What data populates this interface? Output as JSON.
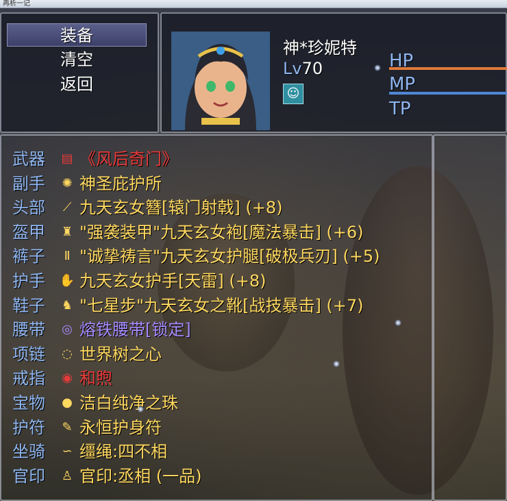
{
  "window": {
    "title": "再析一记"
  },
  "menu": {
    "items": [
      {
        "label": "装备",
        "selected": true
      },
      {
        "label": "清空",
        "selected": false
      },
      {
        "label": "返回",
        "selected": false
      }
    ]
  },
  "actor": {
    "name": "神*珍妮特",
    "level_label": "Lv",
    "level": "70",
    "state_icon": "status-icon",
    "gauges": [
      {
        "label": "HP",
        "fill": 1.0,
        "color": "#e07a3a"
      },
      {
        "label": "MP",
        "fill": 1.0,
        "color": "#4f86d6"
      },
      {
        "label": "TP",
        "fill": 0.0,
        "color": "#4fb36b"
      }
    ]
  },
  "colors": {
    "slot_label": "#8fb6f0",
    "item_default": "#ffd860",
    "item_red": "#e83a3a",
    "item_purple": "#a58cff"
  },
  "equipment": [
    {
      "slot": "武器",
      "icon": "scroll-icon",
      "glyph": "▤",
      "name": "《风后奇门》",
      "color": "#e83a3a"
    },
    {
      "slot": "副手",
      "icon": "shield-icon",
      "glyph": "✺",
      "name": "神圣庇护所",
      "color": "#ffd860"
    },
    {
      "slot": "头部",
      "icon": "hairpin-icon",
      "glyph": "⟋",
      "name": "九天玄女簪[辕门射戟] (+8)",
      "color": "#ffd860"
    },
    {
      "slot": "盔甲",
      "icon": "robe-icon",
      "glyph": "♜",
      "name": "\"强袭装甲\"九天玄女袍[魔法暴击] (+6)",
      "color": "#ffd860"
    },
    {
      "slot": "裤子",
      "icon": "pants-icon",
      "glyph": "Ⅱ",
      "name": "\"诚挚祷言\"九天玄女护腿[破极兵刃] (+5)",
      "color": "#ffd860"
    },
    {
      "slot": "护手",
      "icon": "gauntlet-icon",
      "glyph": "✋",
      "name": "九天玄女护手[天雷] (+8)",
      "color": "#ffd860"
    },
    {
      "slot": "鞋子",
      "icon": "boots-icon",
      "glyph": "♞",
      "name": "\"七星步\"九天玄女之靴[战技暴击] (+7)",
      "color": "#ffd860"
    },
    {
      "slot": "腰带",
      "icon": "belt-icon",
      "glyph": "◎",
      "name": "熔铁腰带[锁定]",
      "color": "#a58cff"
    },
    {
      "slot": "项链",
      "icon": "necklace-icon",
      "glyph": "◌",
      "name": "世界树之心",
      "color": "#ffd860"
    },
    {
      "slot": "戒指",
      "icon": "ring-icon",
      "glyph": "◉",
      "name": "和煦",
      "color": "#e83a3a"
    },
    {
      "slot": "宝物",
      "icon": "pearl-icon",
      "glyph": "●",
      "name": "洁白纯净之珠",
      "color": "#ffd860"
    },
    {
      "slot": "护符",
      "icon": "charm-icon",
      "glyph": "✎",
      "name": "永恒护身符",
      "color": "#ffd860"
    },
    {
      "slot": "坐骑",
      "icon": "rope-icon",
      "glyph": "∽",
      "name": "缰绳:四不相",
      "color": "#ffd860"
    },
    {
      "slot": "官印",
      "icon": "seal-icon",
      "glyph": "♙",
      "name": "官印:丞相 (一品)",
      "color": "#ffd860"
    }
  ]
}
